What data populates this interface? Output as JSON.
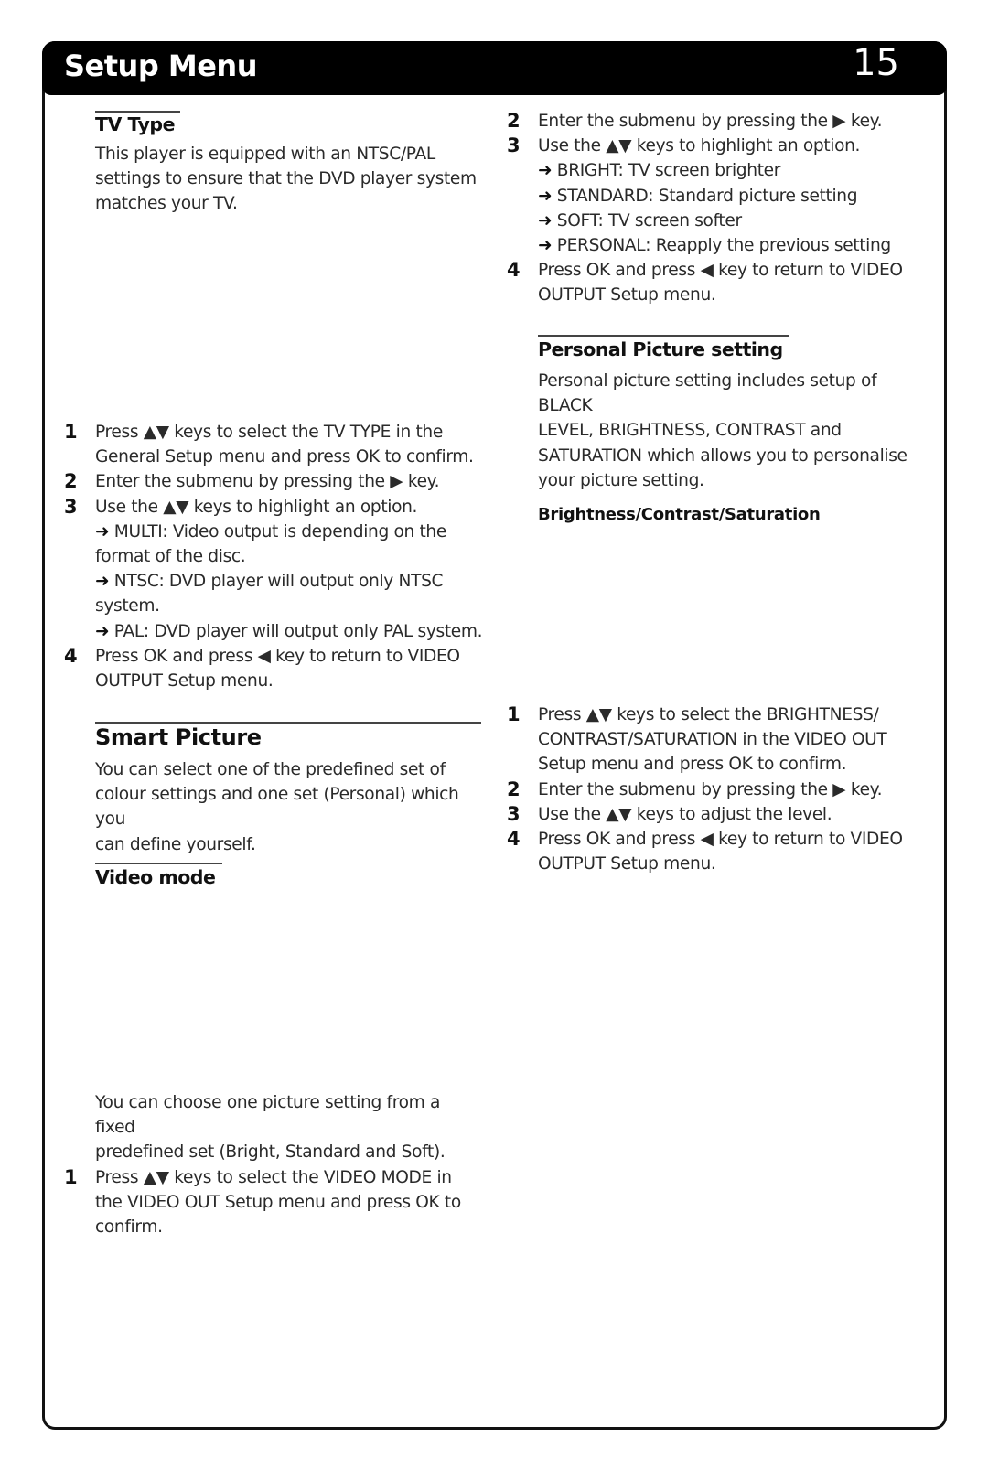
{
  "header": {
    "title": "Setup Menu",
    "page_number": "15"
  },
  "tv_type": {
    "heading": "TV Type",
    "intro": [
      "This player is equipped with an NTSC/PAL",
      "settings to ensure that the DVD player system",
      "matches your TV."
    ],
    "steps": [
      {
        "num": "1",
        "lines": [
          "Press ▲▼ keys to select the TV TYPE in the",
          "General Setup menu and press OK to confirm."
        ]
      },
      {
        "num": "2",
        "lines": [
          "Enter the submenu by pressing the ▶ key."
        ]
      },
      {
        "num": "3",
        "lines": [
          "Use the ▲▼ keys to highlight an option."
        ]
      }
    ],
    "options": [
      {
        "arrow": "➜",
        "first": "MULTI: Video output is depending on the",
        "rest": "format of the disc."
      },
      {
        "arrow": "➜",
        "first": "NTSC: DVD player will output only NTSC",
        "rest": "system."
      },
      {
        "arrow": "➜",
        "first": "PAL: DVD player will output only PAL system.",
        "rest": ""
      }
    ],
    "step4": {
      "num": "4",
      "lines": [
        "Press OK and press ◀ key to return to VIDEO",
        "OUTPUT Setup menu."
      ]
    }
  },
  "smart_picture": {
    "heading": "Smart Picture",
    "intro": [
      "You can select one of the predefined set of",
      "colour settings and one set (Personal) which you",
      "can define yourself."
    ]
  },
  "video_mode": {
    "heading": "Video mode",
    "intro": [
      "You can choose one picture setting from a fixed",
      "predefined set (Bright, Standard and Soft)."
    ],
    "step1": {
      "num": "1",
      "lines": [
        "Press ▲▼ keys to select the VIDEO MODE in",
        "the VIDEO OUT Setup menu and press OK to",
        "confirm."
      ]
    },
    "steps_cont": [
      {
        "num": "2",
        "lines": [
          "Enter the submenu by pressing the ▶ key."
        ]
      },
      {
        "num": "3",
        "lines": [
          "Use the ▲▼ keys to highlight an option."
        ]
      }
    ],
    "options": [
      {
        "arrow": "➜",
        "text": "BRIGHT: TV screen brighter"
      },
      {
        "arrow": "➜",
        "text": "STANDARD: Standard picture setting"
      },
      {
        "arrow": "➜",
        "text": "SOFT: TV screen softer"
      },
      {
        "arrow": "➜",
        "text": "PERSONAL: Reapply the previous setting"
      }
    ],
    "step4": {
      "num": "4",
      "lines": [
        "Press OK and press ◀ key to return to VIDEO",
        "OUTPUT Setup menu."
      ]
    }
  },
  "personal_picture": {
    "heading": "Personal Picture setting",
    "intro": [
      "Personal picture setting includes setup of BLACK",
      "LEVEL, BRIGHTNESS, CONTRAST and",
      "SATURATION which allows you to personalise",
      "your picture setting."
    ],
    "subheading": "Brightness/Contrast/Saturation",
    "steps": [
      {
        "num": "1",
        "lines": [
          "Press ▲▼ keys to select the BRIGHTNESS/",
          "CONTRAST/SATURATION in the VIDEO OUT",
          "Setup menu and press OK to confirm."
        ]
      },
      {
        "num": "2",
        "lines": [
          "Enter the submenu by pressing the ▶ key."
        ]
      },
      {
        "num": "3",
        "lines": [
          "Use the ▲▼ keys to adjust the level."
        ]
      },
      {
        "num": "4",
        "lines": [
          "Press OK and press ◀ key to return to VIDEO",
          "OUTPUT Setup menu."
        ]
      }
    ]
  }
}
